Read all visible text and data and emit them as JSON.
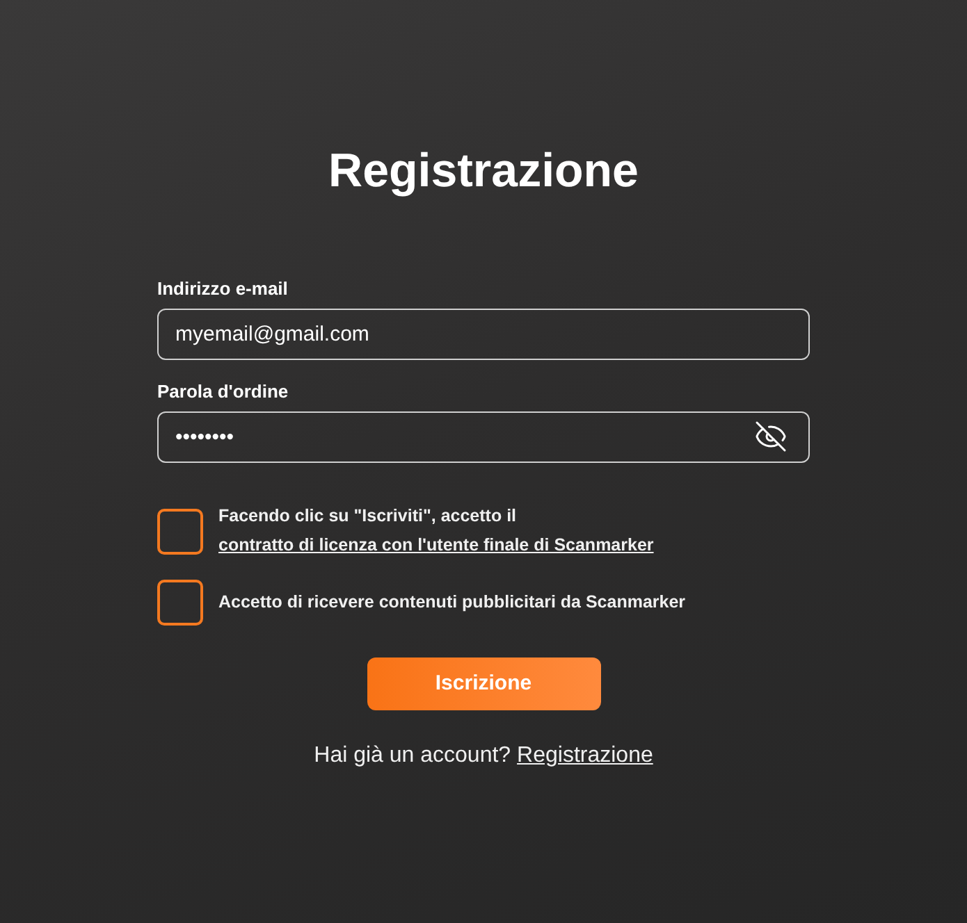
{
  "title": "Registrazione",
  "fields": [
    {
      "label": "Indirizzo e-mail",
      "value": "myemail@gmail.com",
      "kind": "text"
    },
    {
      "label": "Parola d'ordine",
      "value": "••••••••",
      "kind": "password"
    }
  ],
  "consents": [
    {
      "checked": false,
      "text": "Facendo clic su \"Iscriviti\", accetto il",
      "link": "contratto di licenza con l'utente finale di Scanmarker"
    },
    {
      "checked": false,
      "text": "Accetto di ricevere contenuti pubblicitari da Scanmarker"
    }
  ],
  "submit": "Iscrizione",
  "footer": {
    "text": "Hai già un account?",
    "link": "Registrazione"
  }
}
